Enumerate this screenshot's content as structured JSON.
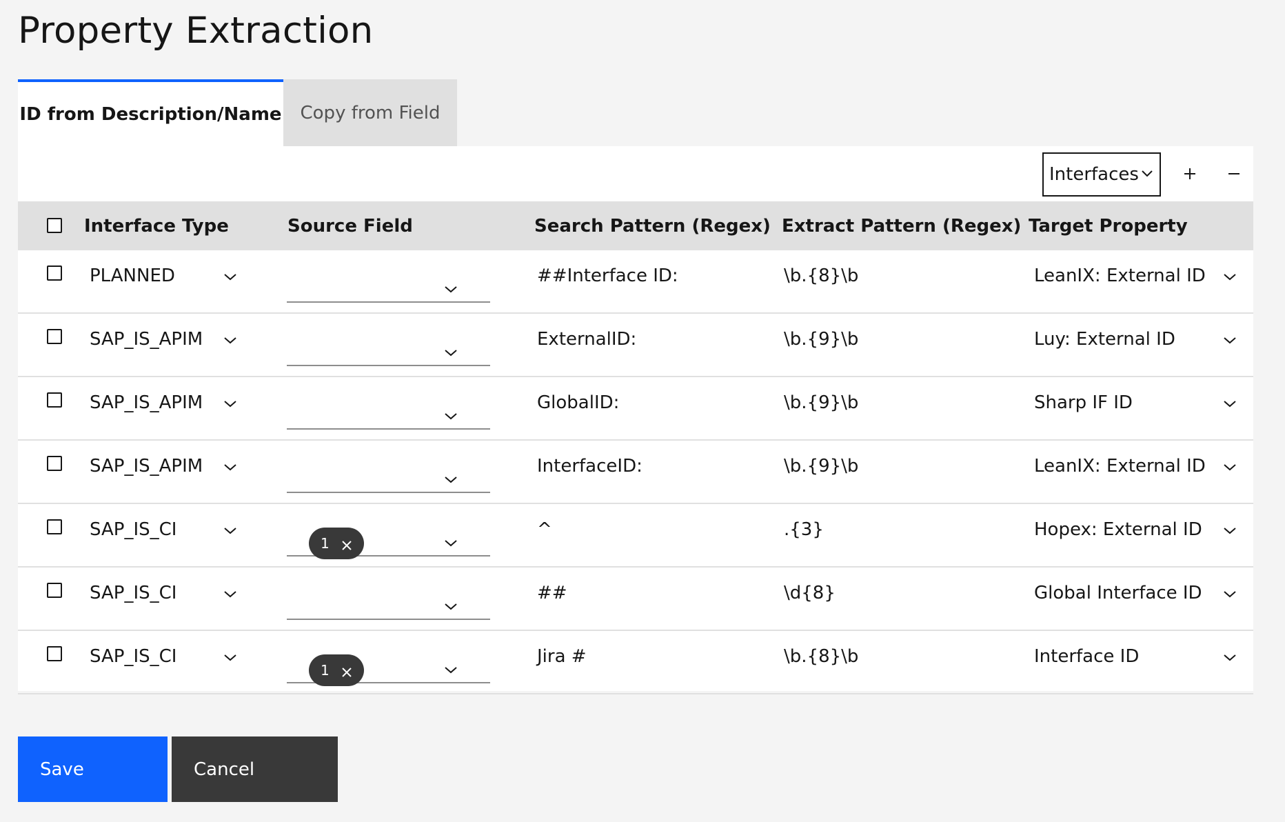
{
  "page": {
    "title": "Property Extraction"
  },
  "tabs": [
    {
      "label": "ID from Description/Name",
      "active": true
    },
    {
      "label": "Copy from Field",
      "active": false
    }
  ],
  "toolbar": {
    "type_select": "Interfaces",
    "add_icon": "plus-icon",
    "remove_icon": "minus-icon"
  },
  "table": {
    "headers": {
      "interface_type": "Interface Type",
      "source_field": "Source Field",
      "search_pattern": "Search Pattern (Regex)",
      "extract_pattern": "Extract Pattern (Regex)",
      "target_property": "Target Property"
    },
    "rows": [
      {
        "interface_type": "PLANNED",
        "source_tag": null,
        "search": "##Interface ID:",
        "extract": "\\b.{8}\\b",
        "target": "LeanIX: External ID"
      },
      {
        "interface_type": "SAP_IS_APIM",
        "source_tag": null,
        "search": "ExternalID:",
        "extract": "\\b.{9}\\b",
        "target": "Luy: External ID"
      },
      {
        "interface_type": "SAP_IS_APIM",
        "source_tag": null,
        "search": "GlobalID:",
        "extract": "\\b.{9}\\b",
        "target": "Sharp IF ID"
      },
      {
        "interface_type": "SAP_IS_APIM",
        "source_tag": null,
        "search": "InterfaceID:",
        "extract": "\\b.{9}\\b",
        "target": "LeanIX: External ID"
      },
      {
        "interface_type": "SAP_IS_CI",
        "source_tag": "1",
        "search": "^",
        "extract": ".{3}",
        "target": "Hopex: External ID"
      },
      {
        "interface_type": "SAP_IS_CI",
        "source_tag": null,
        "search": "##",
        "extract": "\\d{8}",
        "target": "Global Interface ID"
      },
      {
        "interface_type": "SAP_IS_CI",
        "source_tag": "1",
        "search": "Jira #",
        "extract": "\\b.{8}\\b",
        "target": "Interface ID"
      }
    ]
  },
  "actions": {
    "save": "Save",
    "cancel": "Cancel"
  },
  "colors": {
    "primary": "#0f62fe",
    "secondary": "#393939",
    "header_bg": "#e0e0e0",
    "page_bg": "#f4f4f4"
  }
}
